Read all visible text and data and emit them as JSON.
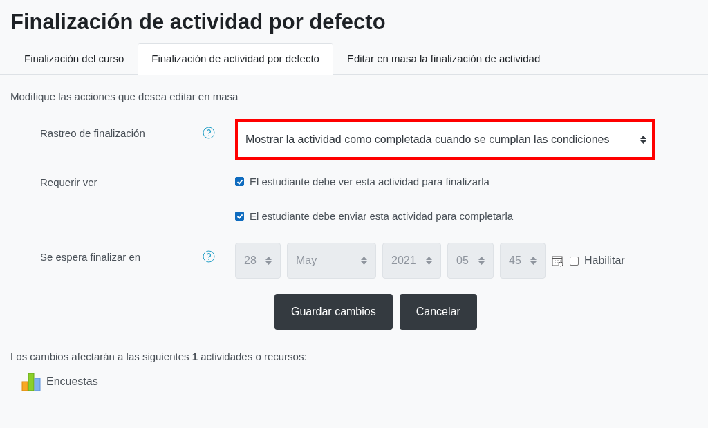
{
  "page_title": "Finalización de actividad por defecto",
  "tabs": [
    {
      "label": "Finalización del curso",
      "selected": false
    },
    {
      "label": "Finalización de actividad por defecto",
      "selected": true
    },
    {
      "label": "Editar en masa la finalización de actividad",
      "selected": false
    }
  ],
  "intro": "Modifique las acciones que desea editar en masa",
  "form": [
    {
      "kind": "select",
      "label": "Rastreo de finalización",
      "help": true,
      "value": "Mostrar la actividad como completada cuando se cumplan las condiciones",
      "highlighted": true
    },
    {
      "kind": "checkboxes",
      "label": "Requerir ver",
      "help": false,
      "options": [
        {
          "label": "El estudiante debe ver esta actividad para finalizarla",
          "checked": true
        },
        {
          "label": "El estudiante debe enviar esta actividad para completarla",
          "checked": true
        }
      ]
    },
    {
      "kind": "date",
      "label": "Se espera finalizar en",
      "help": true,
      "disabled": true,
      "parts": [
        "28",
        "May",
        "2021",
        "05",
        "45"
      ],
      "enable": {
        "label": "Habilitar",
        "checked": false
      }
    }
  ],
  "buttons": [
    {
      "label": "Guardar cambios"
    },
    {
      "label": "Cancelar"
    }
  ],
  "note": "Los cambios afectarán a las siguientes **1** actividades o recursos:",
  "resources": [
    {
      "name": "Encuestas"
    }
  ]
}
